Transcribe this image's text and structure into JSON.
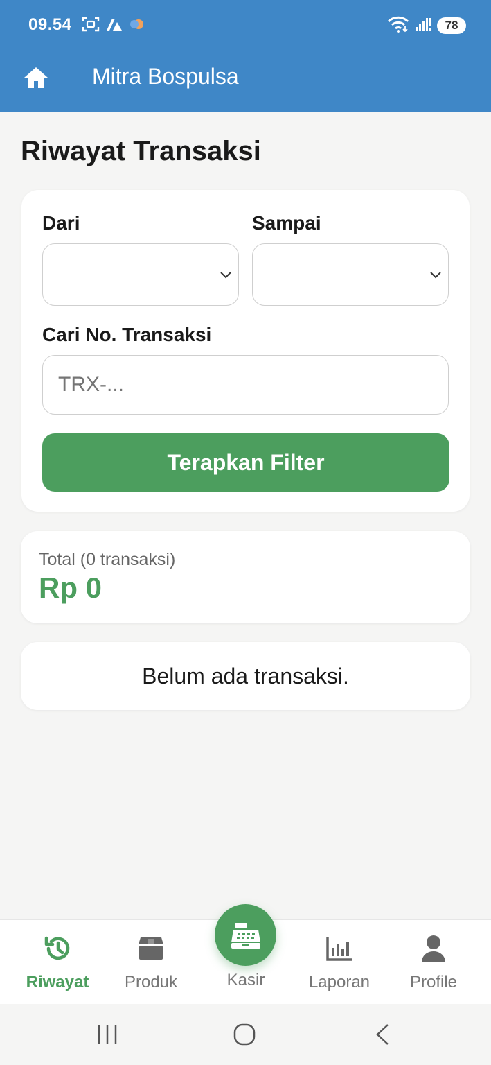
{
  "status": {
    "time": "09.54",
    "battery": "78"
  },
  "header": {
    "title": "Mitra Bospulsa"
  },
  "page": {
    "title": "Riwayat Transaksi"
  },
  "filter": {
    "from_label": "Dari",
    "from_value": "",
    "to_label": "Sampai",
    "to_value": "",
    "search_label": "Cari No. Transaksi",
    "search_placeholder": "TRX-...",
    "search_value": "",
    "apply_label": "Terapkan Filter"
  },
  "summary": {
    "total_label": "Total (0 transaksi)",
    "total_value": "Rp 0"
  },
  "empty_state": {
    "message": "Belum ada transaksi."
  },
  "bottom_nav": {
    "items": [
      {
        "label": "Riwayat",
        "icon": "history-icon",
        "active": true
      },
      {
        "label": "Produk",
        "icon": "box-icon",
        "active": false
      },
      {
        "label": "Kasir",
        "icon": "cash-register-icon",
        "active": false
      },
      {
        "label": "Laporan",
        "icon": "bar-chart-icon",
        "active": false
      },
      {
        "label": "Profile",
        "icon": "user-icon",
        "active": false
      }
    ]
  },
  "colors": {
    "primary_blue": "#3f87c7",
    "accent_green": "#4c9e5e",
    "background": "#f5f5f4"
  }
}
